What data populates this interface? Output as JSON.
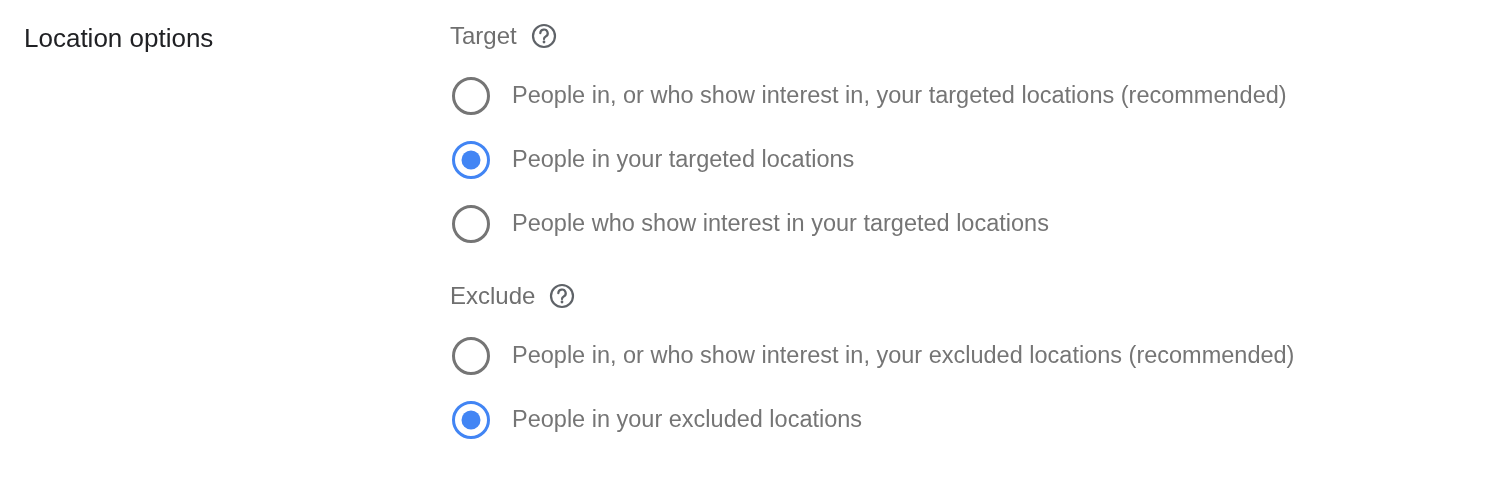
{
  "label": "Location options",
  "groups": [
    {
      "title": "Target",
      "options": [
        {
          "label": "People in, or who show interest in, your targeted locations (recommended)",
          "selected": false
        },
        {
          "label": "People in your targeted locations",
          "selected": true
        },
        {
          "label": "People who show interest in your targeted locations",
          "selected": false
        }
      ]
    },
    {
      "title": "Exclude",
      "options": [
        {
          "label": "People in, or who show interest in, your excluded locations (recommended)",
          "selected": false
        },
        {
          "label": "People in your excluded locations",
          "selected": true
        }
      ]
    }
  ]
}
